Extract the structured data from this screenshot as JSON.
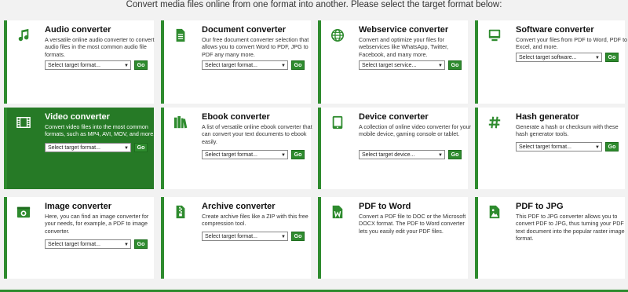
{
  "page": {
    "heading": "Convert media files online from one format into another. Please select the target format below:"
  },
  "colors": {
    "accent": "#2e8b2e",
    "active_card": "#267a26",
    "background": "#f2f2f2"
  },
  "cards": [
    {
      "title": "Audio converter",
      "icon": "music-note-icon",
      "description": "A versatile online audio converter to convert audio files in the most common audio file formats.",
      "select": "Select target format...",
      "button": "Go"
    },
    {
      "title": "Document converter",
      "icon": "document-icon",
      "description": "Our free document converter selection that allows you to convert Word to PDF, JPG to PDF any many more.",
      "select": "Select target format...",
      "button": "Go"
    },
    {
      "title": "Webservice converter",
      "icon": "globe-icon",
      "description": "Convert and optimize your files for webservices like WhatsApp, Twitter, Facebook, and many more.",
      "select": "Select target service...",
      "button": "Go"
    },
    {
      "title": "Software converter",
      "icon": "monitor-icon",
      "description": "Convert your files from PDF to Word, PDF to Excel, and more.",
      "select": "Select target software...",
      "button": "Go"
    },
    {
      "title": "Video converter",
      "icon": "film-icon",
      "description": "Convert video files into the most common formats, such as MP4, AVI, MOV, and more.",
      "select": "Select target format...",
      "button": "Go",
      "active": true
    },
    {
      "title": "Ebook converter",
      "icon": "books-icon",
      "description": "A list of versatile online ebook converter that can convert your text documents to ebook easily.",
      "select": "Select target format...",
      "button": "Go"
    },
    {
      "title": "Device converter",
      "icon": "tablet-icon",
      "description": "A collection of online video converter for your mobile device, gaming console or tablet.",
      "select": "Select target device...",
      "button": "Go"
    },
    {
      "title": "Hash generator",
      "icon": "hash-icon",
      "description": "Generate a hash or checksum with these hash generator tools.",
      "select": "Select target format...",
      "button": "Go"
    },
    {
      "title": "Image converter",
      "icon": "image-icon",
      "description": "Here, you can find an image converter for your needs, for example, a PDF to image converter.",
      "select": "Select target format...",
      "button": "Go"
    },
    {
      "title": "Archive converter",
      "icon": "archive-icon",
      "description": "Create archive files like a ZIP with this free compression tool.",
      "select": "Select target format...",
      "button": "Go"
    },
    {
      "title": "PDF to Word",
      "icon": "word-file-icon",
      "description": "Convert a PDF file to DOC or the Microsoft DOCX format. The PDF to Word converter lets you easily edit your PDF files."
    },
    {
      "title": "PDF to JPG",
      "icon": "jpg-file-icon",
      "description": "This PDF to JPG converter allows you to convert PDF to JPG, thus turning your PDF text document into the popular raster image format."
    }
  ]
}
